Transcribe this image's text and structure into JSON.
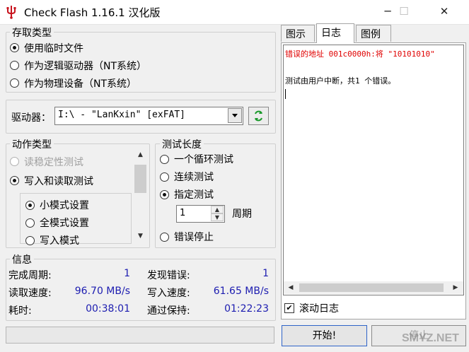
{
  "window": {
    "title": "Check Flash 1.16.1 汉化版",
    "minimize": "─",
    "maximize": "☐",
    "close": "✕"
  },
  "access_type": {
    "legend": "存取类型",
    "options": [
      {
        "label": "使用临时文件",
        "selected": true
      },
      {
        "label": "作为逻辑驱动器（NT系统）",
        "selected": false
      },
      {
        "label": "作为物理设备（NT系统）",
        "selected": false
      }
    ]
  },
  "drive": {
    "label": "驱动器：",
    "value": "I:\\ - \"LanKxin\" [exFAT]",
    "refresh_icon": "refresh-icon"
  },
  "action_type": {
    "legend": "动作类型",
    "options": [
      {
        "label": "读稳定性测试",
        "enabled": false,
        "selected": false
      },
      {
        "label": "写入和读取测试",
        "enabled": true,
        "selected": true
      }
    ],
    "sub_options": [
      {
        "label": "小模式设置",
        "selected": true
      },
      {
        "label": "全模式设置",
        "selected": false
      },
      {
        "label": "写入模式",
        "selected": false
      }
    ]
  },
  "test_length": {
    "legend": "测试长度",
    "options": [
      {
        "label": "一个循环测试",
        "selected": false
      },
      {
        "label": "连续测试",
        "selected": false
      },
      {
        "label": "指定测试",
        "selected": true
      }
    ],
    "cycles_value": "1",
    "cycles_label": "周期",
    "stop_on_error": "错误停止"
  },
  "info": {
    "legend": "信息",
    "cycles_done_label": "完成周期:",
    "cycles_done_value": "1",
    "errors_found_label": "发现错误:",
    "errors_found_value": "1",
    "read_speed_label": "读取速度:",
    "read_speed_value": "96.70 MB/s",
    "write_speed_label": "写入速度:",
    "write_speed_value": "61.65 MB/s",
    "elapsed_label": "耗时:",
    "elapsed_value": "00:38:01",
    "retention_label": "通过保持:",
    "retention_value": "01:22:23"
  },
  "tabs": [
    {
      "label": "图示",
      "active": false
    },
    {
      "label": "日志",
      "active": true
    },
    {
      "label": "图例",
      "active": false
    }
  ],
  "log": {
    "lines": [
      {
        "text": "错误的地址 001c0000h:将 \"10101010\"",
        "color": "#e00000"
      },
      {
        "text": "测试由用户中断，共1 个错误。",
        "color": "#000000"
      }
    ],
    "scroll_log_label": "滚动日志",
    "scroll_log_checked": true
  },
  "buttons": {
    "start": "开始!",
    "stop": "停止"
  },
  "watermark": "SMYZ.NET",
  "colors": {
    "info_value": "#1c1cb0",
    "error_text": "#e00000"
  }
}
